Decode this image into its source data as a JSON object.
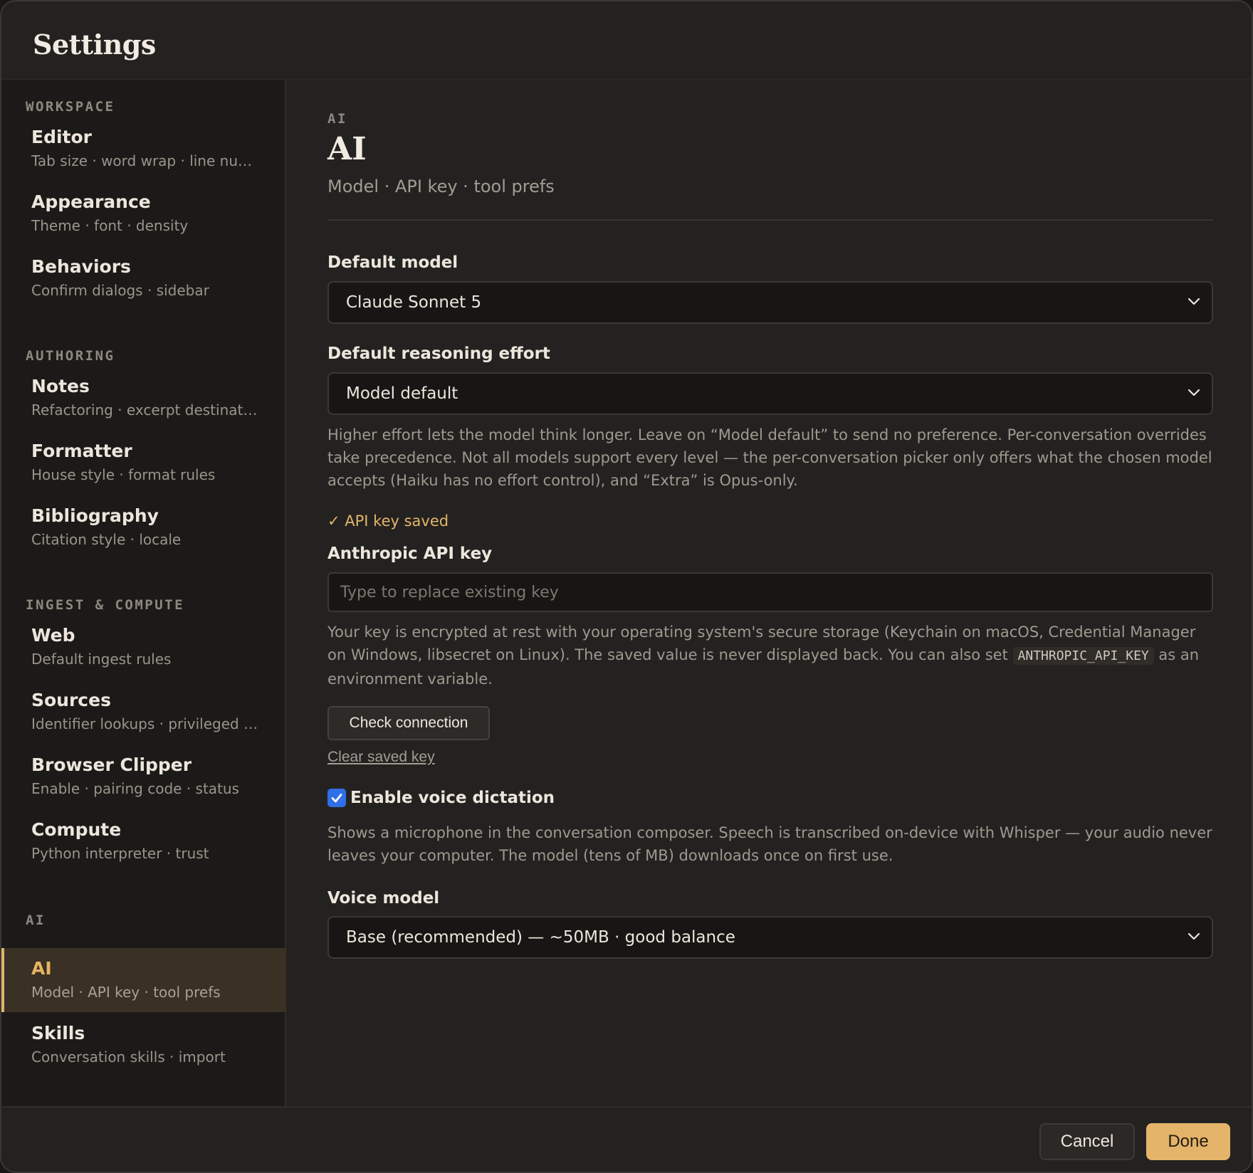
{
  "dialog": {
    "title": "Settings"
  },
  "sidebar": {
    "groups": [
      {
        "label": "WORKSPACE",
        "items": [
          {
            "title": "Editor",
            "subtitle": "Tab size · word wrap · line numb..."
          },
          {
            "title": "Appearance",
            "subtitle": "Theme · font · density"
          },
          {
            "title": "Behaviors",
            "subtitle": "Confirm dialogs · sidebar"
          }
        ]
      },
      {
        "label": "AUTHORING",
        "items": [
          {
            "title": "Notes",
            "subtitle": "Refactoring · excerpt destinations"
          },
          {
            "title": "Formatter",
            "subtitle": "House style · format rules"
          },
          {
            "title": "Bibliography",
            "subtitle": "Citation style · locale"
          }
        ]
      },
      {
        "label": "INGEST & COMPUTE",
        "items": [
          {
            "title": "Web",
            "subtitle": "Default ingest rules"
          },
          {
            "title": "Sources",
            "subtitle": "Identifier lookups · privileged lo..."
          },
          {
            "title": "Browser Clipper",
            "subtitle": "Enable · pairing code · status"
          },
          {
            "title": "Compute",
            "subtitle": "Python interpreter · trust"
          }
        ]
      },
      {
        "label": "AI",
        "items": [
          {
            "title": "AI",
            "subtitle": "Model · API key · tool prefs",
            "active": true
          },
          {
            "title": "Skills",
            "subtitle": "Conversation skills · import"
          }
        ]
      }
    ]
  },
  "main": {
    "eyebrow": "AI",
    "title": "AI",
    "subtitle": "Model · API key · tool prefs",
    "default_model": {
      "label": "Default model",
      "value": "Claude Sonnet 5"
    },
    "reasoning": {
      "label": "Default reasoning effort",
      "value": "Model default",
      "help": "Higher effort lets the model think longer. Leave on “Model default” to send no preference. Per-conversation overrides take precedence. Not all models support every level — the per-conversation picker only offers what the chosen model accepts (Haiku has no effort control), and “Extra” is Opus-only."
    },
    "api_key": {
      "status": "✓ API key saved",
      "label": "Anthropic API key",
      "placeholder": "Type to replace existing key",
      "help_before": "Your key is encrypted at rest with your operating system's secure storage (Keychain on macOS, Credential Manager on Windows, libsecret on Linux). The saved value is never displayed back. You can also set ",
      "help_code": "ANTHROPIC_API_KEY",
      "help_after": " as an environment variable.",
      "check_button": "Check connection",
      "clear_link": "Clear saved key"
    },
    "voice": {
      "checkbox_label": "Enable voice dictation",
      "checked": true,
      "help": "Shows a microphone in the conversation composer. Speech is transcribed on-device with Whisper — your audio never leaves your computer. The model (tens of MB) downloads once on first use.",
      "model_label": "Voice model",
      "model_value": "Base (recommended) — ~50MB · good balance"
    }
  },
  "footer": {
    "cancel": "Cancel",
    "done": "Done"
  },
  "colors": {
    "accent": "#e3b469",
    "background": "#242220",
    "sidebar": "#1c1a18",
    "checkbox": "#2f6fe8"
  },
  "icons": {
    "select_chevron": "chevron-down-icon",
    "checkmark": "check-icon"
  }
}
